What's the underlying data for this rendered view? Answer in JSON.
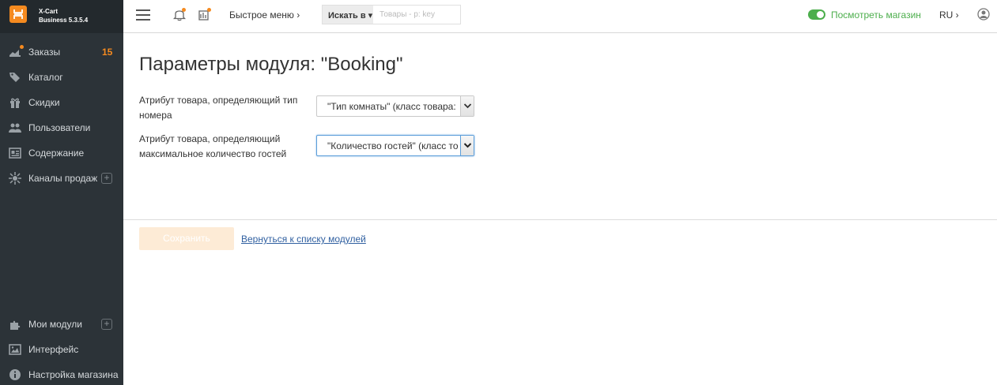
{
  "brand": {
    "name_line1": "X-Cart",
    "name_line2": "Business 5.3.5.4"
  },
  "sidebar": {
    "items": [
      {
        "label": "Заказы",
        "badge": "15"
      },
      {
        "label": "Каталог"
      },
      {
        "label": "Скидки"
      },
      {
        "label": "Пользователи"
      },
      {
        "label": "Содержание"
      },
      {
        "label": "Каналы продаж"
      },
      {
        "label": "Мои модули"
      },
      {
        "label": "Интерфейс"
      },
      {
        "label": "Настройка магазина"
      }
    ]
  },
  "header": {
    "quick_menu": "Быстрое меню ›",
    "search_in": "Искать в ▾",
    "search_placeholder": "Товары - р: key",
    "store_link": "Посмотреть магазин",
    "lang": "RU ›"
  },
  "main": {
    "title": "Параметры модуля: \"Booking\"",
    "fields": [
      {
        "label": "Атрибут товара, определяющий тип номера",
        "value": "\"Тип комнаты\" (класс товара:"
      },
      {
        "label": "Атрибут товара, определяющий максимальное количество гостей",
        "value": "\"Количество гостей\" (класс то"
      }
    ],
    "save_label": "Сохранить",
    "back_label": "Вернуться к списку модулей"
  },
  "colors": {
    "accent": "#f58a1f",
    "sidebar_bg": "#2c3338",
    "success": "#4cae4c",
    "link": "#2f5fa0"
  }
}
